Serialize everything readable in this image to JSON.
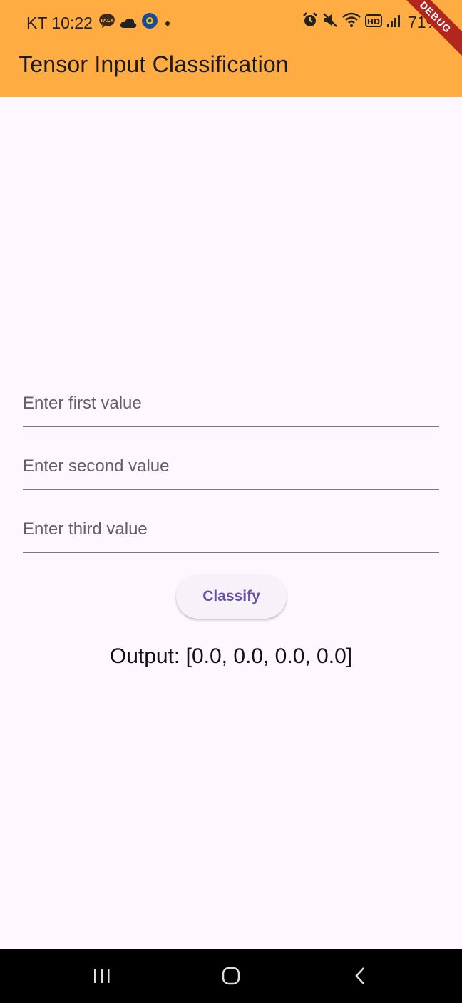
{
  "status_bar": {
    "carrier_time": "KT 10:22",
    "battery": "71%",
    "left_icons": [
      "kakaotalk-icon",
      "cloud-icon",
      "app-notification-icon",
      "dot-icon"
    ],
    "right_icons": [
      "alarm-icon",
      "mute-icon",
      "wifi-icon",
      "hd-icon",
      "signal-icon",
      "battery-icon"
    ]
  },
  "app_bar": {
    "title": "Tensor Input Classification",
    "debug_label": "DEBUG",
    "color": "#ffad42"
  },
  "form": {
    "first_placeholder": "Enter first value",
    "second_placeholder": "Enter second value",
    "third_placeholder": "Enter third value",
    "classify_label": "Classify"
  },
  "output": {
    "text": "Output: [0.0, 0.0, 0.0, 0.0]"
  },
  "nav_bar": {
    "icons": [
      "recent-apps-icon",
      "home-icon",
      "back-icon"
    ]
  }
}
